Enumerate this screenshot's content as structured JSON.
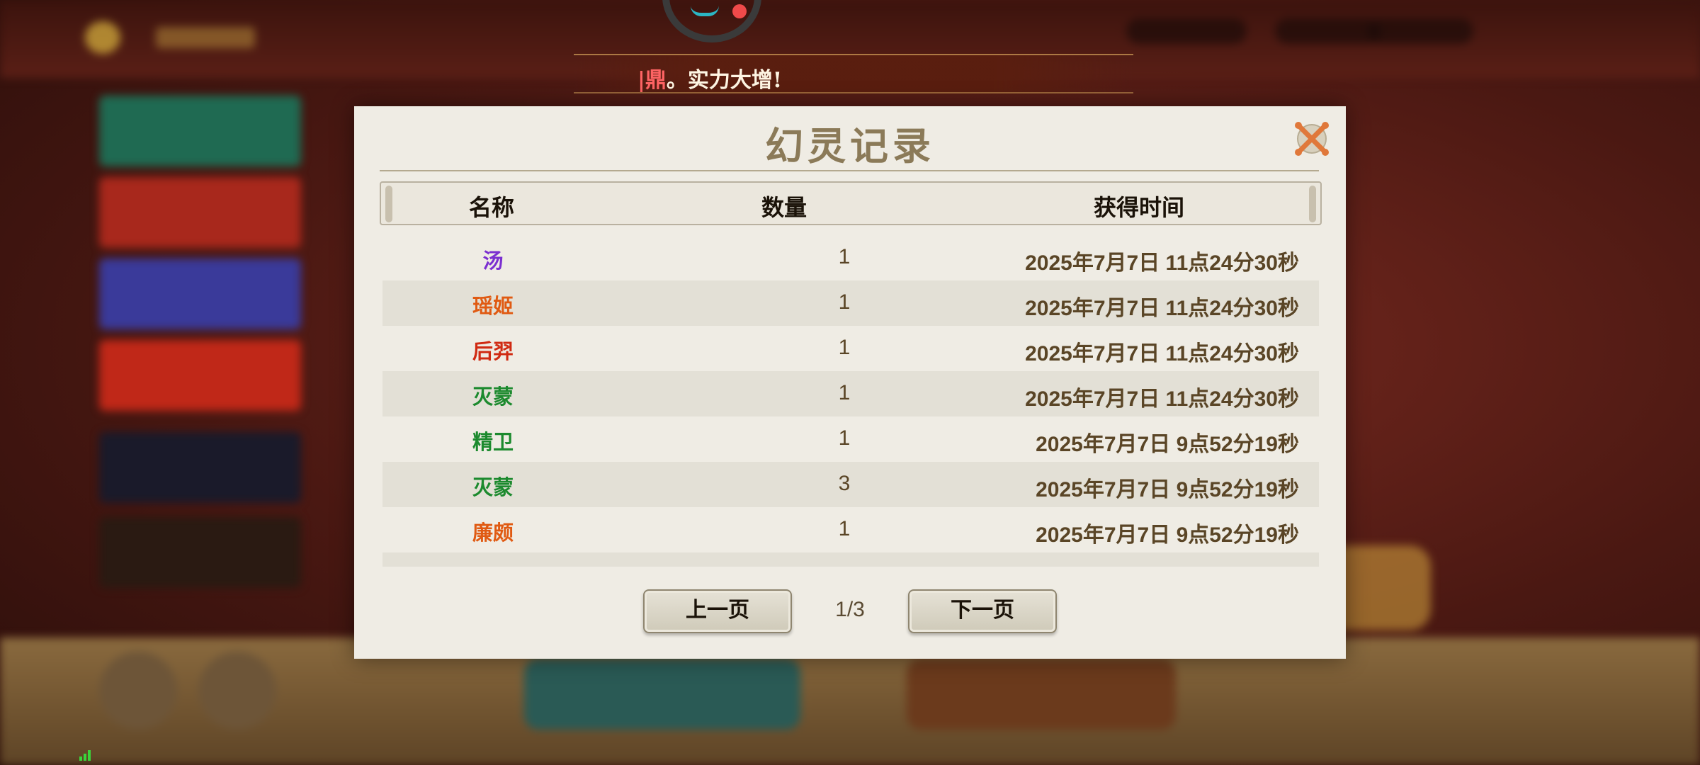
{
  "banner": {
    "highlight": "|鼎",
    "text": "。实力大增!"
  },
  "dialog": {
    "title": "幻灵记录",
    "columns": {
      "name": "名称",
      "quantity": "数量",
      "time": "获得时间"
    },
    "rows": [
      {
        "name": "汤",
        "name_color": "#7b2fd0",
        "quantity": "1",
        "time": "2025年7月7日  11点24分30秒"
      },
      {
        "name": "瑶姬",
        "name_color": "#e05a12",
        "quantity": "1",
        "time": "2025年7月7日  11点24分30秒"
      },
      {
        "name": "后羿",
        "name_color": "#d02a12",
        "quantity": "1",
        "time": "2025年7月7日  11点24分30秒"
      },
      {
        "name": "灭蒙",
        "name_color": "#1c8a2e",
        "quantity": "1",
        "time": "2025年7月7日  11点24分30秒"
      },
      {
        "name": "精卫",
        "name_color": "#1c8a2e",
        "quantity": "1",
        "time": "2025年7月7日  9点52分19秒"
      },
      {
        "name": "灭蒙",
        "name_color": "#1c8a2e",
        "quantity": "3",
        "time": "2025年7月7日  9点52分19秒"
      },
      {
        "name": "廉颇",
        "name_color": "#e05a12",
        "quantity": "1",
        "time": "2025年7月7日  9点52分19秒"
      },
      {
        "name": "",
        "name_color": "#1c8a2e",
        "quantity": "",
        "time": ""
      }
    ],
    "prev_label": "上一页",
    "next_label": "下一页",
    "page_indicator": "1/3"
  },
  "icons": {
    "close": "close-icon",
    "signal": "signal-icon"
  },
  "colors": {
    "accent_title": "#8b7a58",
    "text_dark": "#5a4526",
    "close_orange": "#e0783a"
  }
}
